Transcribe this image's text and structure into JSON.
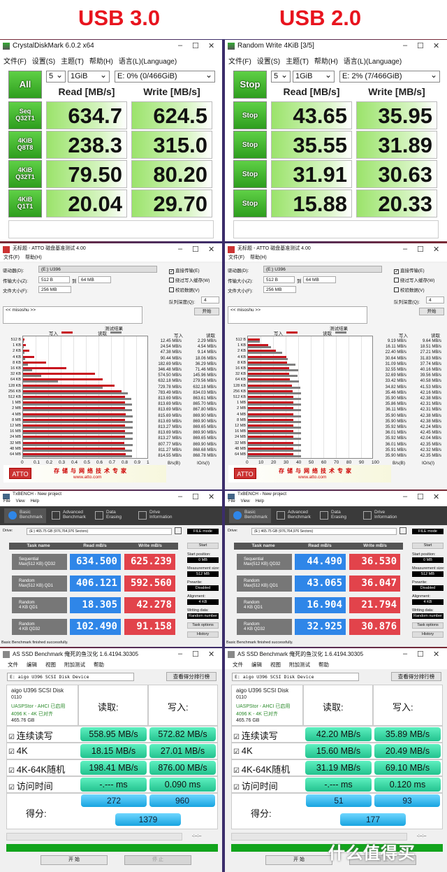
{
  "header": {
    "left_label": "USB 3.0",
    "right_label": "USB 2.0"
  },
  "panels": [
    {
      "cdm": {
        "title": "CrystalDiskMark 6.0.2 x64",
        "menu": [
          "文件(F)",
          "设置(S)",
          "主题(T)",
          "帮助(H)",
          "语言(L)(Language)"
        ],
        "all_button": "All",
        "count": "5",
        "size": "1GiB",
        "drive": "E: 0% (0/466GiB)",
        "read_header": "Read [MB/s]",
        "write_header": "Write [MB/s]",
        "rows": [
          {
            "label1": "Seq",
            "label2": "Q32T1",
            "read": "634.7",
            "write": "624.5"
          },
          {
            "label1": "4KiB",
            "label2": "Q8T8",
            "read": "238.3",
            "write": "315.0"
          },
          {
            "label1": "4KiB",
            "label2": "Q32T1",
            "read": "79.50",
            "write": "80.20"
          },
          {
            "label1": "4KiB",
            "label2": "Q1T1",
            "read": "20.04",
            "write": "29.70"
          }
        ]
      },
      "atto": {
        "title": "无标题 - ATTO 磁盘基准测试 4.00",
        "menu": [
          "文件(F)",
          "帮助(H)"
        ],
        "drive_label": "驱动器(D):",
        "drive": "(E:) U396",
        "transfer_label": "传输大小(Z):",
        "transfer_from": "512 B",
        "to_label": "到",
        "transfer_to": "64 MB",
        "file_label": "文件大小(F):",
        "file_size": "256 MB",
        "checkboxes": [
          {
            "label": "直接传输(E)",
            "checked": true
          },
          {
            "label": "绕过写入缓存(W)",
            "checked": false
          },
          {
            "label": "校验数据(V)",
            "checked": false
          }
        ],
        "queue_label": "队列深度(Q):",
        "queue": "4",
        "notes": "<< misoshu >>",
        "start": "开始",
        "results_title": "测试结果",
        "write_col": "写入",
        "read_col": "读取",
        "radio_bytes": "B/s(B)",
        "radio_io": "IO/s(I)",
        "logo": "ATTO",
        "slogan": "存储与网络技术专家",
        "url": "www.atto.com"
      },
      "txbench": {
        "title": "TxBENCH - New project",
        "menu": [
          "File",
          "View",
          "Help"
        ],
        "tabs": [
          "Basic Benchmark",
          "Advanced Benchmark",
          "Data Erasing",
          "Drive Information"
        ],
        "drive_label": "Drive:",
        "drive": "(E:)  465.75 GB (976,764,976 Sectors)",
        "mode": "FILE mode",
        "headers": [
          "Task name",
          "Read mB/s",
          "Write mB/s"
        ],
        "rows": [
          {
            "name1": "Sequential",
            "name2": "Max(512 KB) QD32",
            "read": "634.500",
            "write": "625.239"
          },
          {
            "name1": "Random",
            "name2": "Max(512 KB) QD1",
            "read": "406.121",
            "write": "592.560"
          },
          {
            "name1": "Random",
            "name2": "4 KB QD1",
            "read": "18.305",
            "write": "42.278"
          },
          {
            "name1": "Random",
            "name2": "4 KB QD32",
            "read": "102.490",
            "write": "91.158"
          }
        ],
        "start": "Start",
        "start_pos_label": "Start position:",
        "start_pos": "0 MB",
        "meas_label": "Measurement size:",
        "meas": "512 MB",
        "prewrite_label": "Prewrite:",
        "prewrite": "Disabled",
        "align_label": "Alignment:",
        "align": "4 KB",
        "wdata_label": "Writing data:",
        "wdata": "Random number",
        "task_options": "Task options",
        "history": "History",
        "status": "Basic Benchmark finished successfully."
      },
      "asssd": {
        "title": "AS SSD Benchmark 俺死的鱼汉化 1.6.4194.30305",
        "menu": [
          "文件",
          "编辑",
          "视图",
          "附加测试",
          "帮助"
        ],
        "drive": "E:  aigo U396 SCSI Disk Device",
        "rank_button": "查看得分排行榜",
        "info": [
          "aigo U396 SCSI Disk",
          "0110",
          "UASPStor - AHCI 已启用",
          "4096 K - 4K 已对齐",
          "465.76 GB"
        ],
        "read_header": "读取:",
        "write_header": "写入:",
        "rows": [
          {
            "label": "连续读写",
            "read": "558.95 MB/s",
            "write": "572.82 MB/s"
          },
          {
            "label": "4K",
            "read": "18.15 MB/s",
            "write": "27.01 MB/s"
          },
          {
            "label": "4K-64K随机",
            "read": "198.41 MB/s",
            "write": "876.00 MB/s"
          },
          {
            "label": "访问时间",
            "read": "-.--- ms",
            "write": "0.090 ms"
          }
        ],
        "score_label": "得分:",
        "score_read": "272",
        "score_write": "960",
        "score_total": "1379",
        "time": "-:--:--",
        "start": "开 始",
        "stop": "停 止",
        "progress": 1.0
      }
    },
    {
      "cdm": {
        "title": "Random Write 4KiB [3/5]",
        "menu": [
          "文件(F)",
          "设置(S)",
          "主题(T)",
          "帮助(H)",
          "语言(L)(Language)"
        ],
        "all_button": "Stop",
        "count": "5",
        "size": "1GiB",
        "drive": "E: 2% (7/466GiB)",
        "read_header": "Read [MB/s]",
        "write_header": "Write [MB/s]",
        "rows": [
          {
            "label1": "Stop",
            "label2": "",
            "read": "43.65",
            "write": "35.95"
          },
          {
            "label1": "Stop",
            "label2": "",
            "read": "35.55",
            "write": "31.89"
          },
          {
            "label1": "Stop",
            "label2": "",
            "read": "31.91",
            "write": "30.63"
          },
          {
            "label1": "Stop",
            "label2": "",
            "read": "15.88",
            "write": "20.33"
          }
        ]
      },
      "atto": {
        "title": "无标题 - ATTO 磁盘基准测试 4.00",
        "menu": [
          "文件(F)",
          "帮助(H)"
        ],
        "drive_label": "驱动器(D):",
        "drive": "(E:) U396",
        "transfer_label": "传输大小(Z):",
        "transfer_from": "512 B",
        "to_label": "到",
        "transfer_to": "64 MB",
        "file_label": "文件大小(F):",
        "file_size": "256 MB",
        "checkboxes": [
          {
            "label": "直接传输(E)",
            "checked": true
          },
          {
            "label": "绕过写入缓存(W)",
            "checked": false
          },
          {
            "label": "校验数据(V)",
            "checked": false
          }
        ],
        "queue_label": "队列深度(Q):",
        "queue": "4",
        "notes": "<< misoshu >>",
        "start": "开始",
        "results_title": "测试结果",
        "write_col": "写入",
        "read_col": "读取",
        "radio_bytes": "B/s(B)",
        "radio_io": "IO/s(I)",
        "logo": "ATTO",
        "slogan": "存储与网络技术专家",
        "url": "www.atto.com"
      },
      "txbench": {
        "title": "TxBENCH - New project",
        "menu": [
          "File",
          "View",
          "Help"
        ],
        "tabs": [
          "Basic Benchmark",
          "Advanced Benchmark",
          "Data Erasing",
          "Drive Information"
        ],
        "drive_label": "Drive:",
        "drive": "(E:)  465.75 GB (976,764,976 Sectors)",
        "mode": "FILE mode",
        "headers": [
          "Task name",
          "Read mB/s",
          "Write mB/s"
        ],
        "rows": [
          {
            "name1": "Sequential",
            "name2": "Max(512 KB) QD32",
            "read": "44.490",
            "write": "36.530"
          },
          {
            "name1": "Random",
            "name2": "Max(512 KB) QD1",
            "read": "43.065",
            "write": "36.047"
          },
          {
            "name1": "Random",
            "name2": "4 KB QD1",
            "read": "16.904",
            "write": "21.794"
          },
          {
            "name1": "Random",
            "name2": "4 KB QD32",
            "read": "32.925",
            "write": "30.876"
          }
        ],
        "start": "Start",
        "start_pos_label": "Start position:",
        "start_pos": "0 MB",
        "meas_label": "Measurement size:",
        "meas": "512 MB",
        "prewrite_label": "Prewrite:",
        "prewrite": "Disabled",
        "align_label": "Alignment:",
        "align": "4 KB",
        "wdata_label": "Writing data:",
        "wdata": "Random number",
        "task_options": "Task options",
        "history": "History",
        "status": "Basic Benchmark finished successfully."
      },
      "asssd": {
        "title": "AS SSD Benchmark 俺死的鱼汉化 1.6.4194.30305",
        "menu": [
          "文件",
          "编辑",
          "视图",
          "附加测试",
          "帮助"
        ],
        "drive": "E:  aigo U396 SCSI Disk Device",
        "rank_button": "查看得分排行榜",
        "info": [
          "aigo U396 SCSI Disk",
          "0110",
          "UASPStor - AHCI 已启用",
          "4096 K - 4K 已对齐",
          "465.76 GB"
        ],
        "read_header": "读取:",
        "write_header": "写入:",
        "rows": [
          {
            "label": "连续读写",
            "read": "42.20 MB/s",
            "write": "35.89 MB/s"
          },
          {
            "label": "4K",
            "read": "15.60 MB/s",
            "write": "20.49 MB/s"
          },
          {
            "label": "4K-64K随机",
            "read": "31.19 MB/s",
            "write": "69.10 MB/s"
          },
          {
            "label": "访问时间",
            "read": "-.--- ms",
            "write": "0.120 ms"
          }
        ],
        "score_label": "得分:",
        "score_read": "51",
        "score_write": "93",
        "score_total": "177",
        "time": "-:--:--",
        "start": "开 始",
        "stop": "停 止",
        "progress": 1.0
      }
    }
  ],
  "watermark": "什么值得买",
  "colors": {
    "write": "#c8141e",
    "read": "#808080",
    "cdm_green": "#3cb82a",
    "tx_read": "#2f86e8",
    "tx_write": "#e2434b",
    "as_green": "#2ed3a0",
    "as_blue": "#1aa8e2"
  },
  "chart_data": [
    {
      "type": "bar",
      "orientation": "horizontal",
      "xlabel": "传输速率 - GB/s",
      "unit": "MB/s",
      "xlim": [
        0,
        1
      ],
      "xticks": [
        "0",
        "0.1",
        "0.2",
        "0.3",
        "0.4",
        "0.5",
        "0.6",
        "0.7",
        "0.8",
        "0.9",
        "1"
      ],
      "legend": "top",
      "grid": true,
      "categories": [
        "512 B",
        "1 KB",
        "2 KB",
        "4 KB",
        "8 KB",
        "16 KB",
        "32 KB",
        "64 KB",
        "128 KB",
        "256 KB",
        "512 KB",
        "1 MB",
        "2 MB",
        "4 MB",
        "8 MB",
        "12 MB",
        "16 MB",
        "24 MB",
        "32 MB",
        "48 MB",
        "64 MB"
      ],
      "series": [
        {
          "name": "写入",
          "values": [
            12.45,
            24.54,
            47.38,
            90.44,
            182.69,
            346.48,
            574.5,
            632.18,
            729.78,
            783.49,
            813.69,
            813.69,
            813.69,
            815.69,
            813.69,
            813.27,
            813.69,
            813.27,
            807.77,
            811.27,
            814.55
          ]
        },
        {
          "name": "读取",
          "values": [
            2.29,
            4.54,
            9.14,
            18.06,
            36.29,
            71.46,
            145.96,
            279.56,
            632.18,
            834.03,
            863.61,
            865.7,
            867.8,
            869.9,
            869.9,
            869.65,
            869.9,
            869.65,
            869.9,
            868.68,
            868.78
          ]
        }
      ]
    },
    {
      "type": "bar",
      "orientation": "horizontal",
      "xlabel": "传输速率 - MB/s",
      "unit": "MB/s",
      "xlim": [
        0,
        100
      ],
      "xticks": [
        "0",
        "10",
        "20",
        "30",
        "40",
        "50",
        "60",
        "70",
        "80",
        "90",
        "100"
      ],
      "legend": "top",
      "grid": true,
      "categories": [
        "512 B",
        "1 KB",
        "2 KB",
        "4 KB",
        "8 KB",
        "16 KB",
        "32 KB",
        "64 KB",
        "128 KB",
        "256 KB",
        "512 KB",
        "1 MB",
        "2 MB",
        "4 MB",
        "8 MB",
        "12 MB",
        "16 MB",
        "24 MB",
        "32 MB",
        "48 MB",
        "64 MB"
      ],
      "series": [
        {
          "name": "写入",
          "values": [
            9.19,
            16.11,
            22.4,
            30.64,
            31.09,
            32.55,
            32.69,
            33.42,
            34.82,
            35.46,
            35.9,
            35.86,
            36.11,
            35.9,
            35.9,
            35.92,
            36.01,
            35.92,
            36.01,
            35.91,
            35.9
          ]
        },
        {
          "name": "读取",
          "values": [
            9.64,
            18.51,
            27.21,
            31.83,
            37.74,
            40.16,
            39.56,
            40.58,
            41.53,
            42.16,
            42.38,
            42.31,
            42.31,
            42.38,
            42.38,
            42.24,
            42.45,
            42.04,
            42.35,
            42.32,
            42.35
          ]
        }
      ]
    }
  ]
}
